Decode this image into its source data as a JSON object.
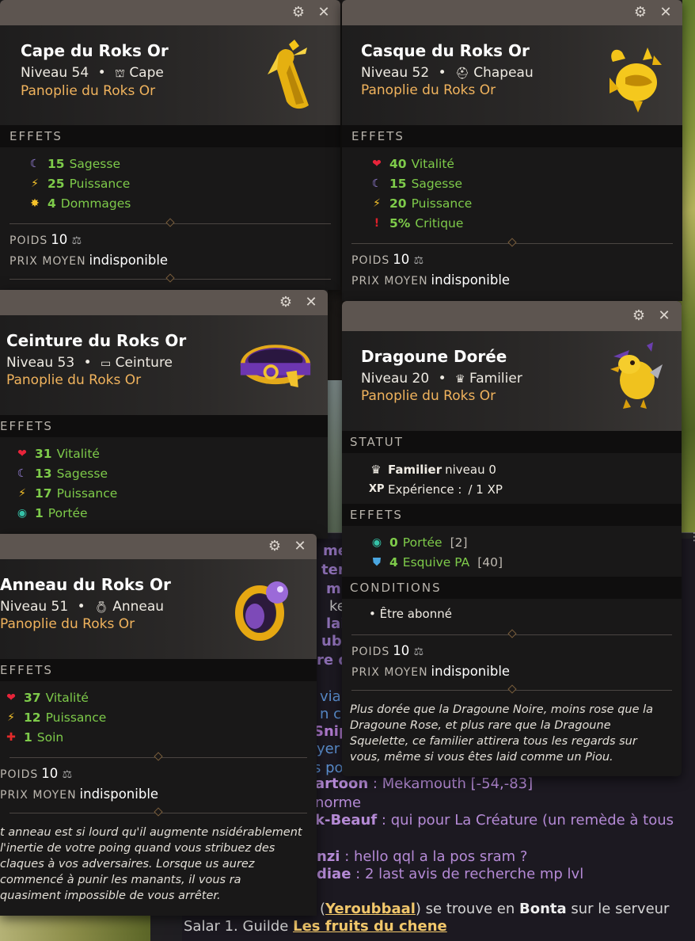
{
  "chat": {
    "lines": [
      {
        "name": "artoon",
        "message": ": Mekamouth [-54,-83]"
      },
      {
        "name": "",
        "message": "norme"
      },
      {
        "name": "k-Beauf",
        "message": ": qui pour La Créature (un remède à tous"
      },
      {
        "name": "nzi",
        "message": ": hello qql a la pos sram ?"
      },
      {
        "name": "diae",
        "message": ": 2 last avis de recherche mp lvl"
      }
    ],
    "system_line1": {
      "pre": "(",
      "user": "Yeroubbaal",
      "mid": ") se trouve en ",
      "place": "Bonta",
      "post": " sur le serveur"
    },
    "system_line2": {
      "pre": "Salar 1. Guilde ",
      "guild": "Les fruits du chene"
    },
    "fragments": [
      "me",
      "ter",
      "mp",
      "ke",
      "lai",
      "ub",
      "re d",
      "via",
      "n co",
      "Snip",
      "yer",
      "s po"
    ]
  },
  "cape": {
    "title": "Cape du Roks Or",
    "level": "Niveau 54",
    "type": "Cape",
    "set": "Panoplie du Roks Or",
    "effects_header": "EFFETS",
    "effects": [
      {
        "icon": "wisdom-icon",
        "value": "15",
        "label": "Sagesse"
      },
      {
        "icon": "power-icon",
        "value": "25",
        "label": "Puissance"
      },
      {
        "icon": "damage-icon",
        "value": "4",
        "label": "Dommages"
      }
    ],
    "weight_label": "POIDS",
    "weight_value": "10",
    "price_label": "PRIX MOYEN",
    "price_value": "indisponible"
  },
  "casque": {
    "title": "Casque du Roks Or",
    "level": "Niveau 52",
    "type": "Chapeau",
    "set": "Panoplie du Roks Or",
    "effects_header": "EFFETS",
    "effects": [
      {
        "icon": "vitality-icon",
        "value": "40",
        "label": "Vitalité"
      },
      {
        "icon": "wisdom-icon",
        "value": "15",
        "label": "Sagesse"
      },
      {
        "icon": "power-icon",
        "value": "20",
        "label": "Puissance"
      },
      {
        "icon": "critical-icon",
        "value": "5%",
        "label": "Critique"
      }
    ],
    "weight_label": "POIDS",
    "weight_value": "10",
    "price_label": "PRIX MOYEN",
    "price_value": "indisponible"
  },
  "ceinture": {
    "title": "Ceinture du Roks Or",
    "level": "Niveau 53",
    "type": "Ceinture",
    "set": "Panoplie du Roks Or",
    "effects_header": "EFFETS",
    "effects": [
      {
        "icon": "vitality-icon",
        "value": "31",
        "label": "Vitalité"
      },
      {
        "icon": "wisdom-icon",
        "value": "13",
        "label": "Sagesse"
      },
      {
        "icon": "power-icon",
        "value": "17",
        "label": "Puissance"
      },
      {
        "icon": "range-icon",
        "value": "1",
        "label": "Portée"
      }
    ]
  },
  "anneau": {
    "title": "Anneau du Roks Or",
    "level": "Niveau 51",
    "type": "Anneau",
    "set": "Panoplie du Roks Or",
    "effects_header": "EFFETS",
    "effects": [
      {
        "icon": "vitality-icon",
        "value": "37",
        "label": "Vitalité"
      },
      {
        "icon": "power-icon",
        "value": "12",
        "label": "Puissance"
      },
      {
        "icon": "heal-icon",
        "value": "1",
        "label": "Soin"
      }
    ],
    "weight_label": "POIDS",
    "weight_value": "10",
    "price_label": "PRIX MOYEN",
    "price_value": "indisponible",
    "description": "t anneau est si lourd qu'il augmente nsidérablement l'inertie de votre poing quand vous stribuez des claques à vos adversaires. Lorsque us aurez commencé à punir les manants, il vous ra quasiment impossible de vous arrêter."
  },
  "dragoune": {
    "title": "Dragoune Dorée",
    "level": "Niveau 20",
    "type": "Familier",
    "set": "Panoplie du Roks Or",
    "status_header": "STATUT",
    "status_pet_label": "Familier",
    "status_pet_value": "niveau 0",
    "status_xp_label": "Expérience :",
    "status_xp_value": "/ 1 XP",
    "effects_header": "EFFETS",
    "effects": [
      {
        "icon": "range-icon",
        "value": "0",
        "label": "Portée",
        "extra": "[2]"
      },
      {
        "icon": "ap-dodge-icon",
        "value": "4",
        "label": "Esquive PA",
        "extra": "[40]"
      }
    ],
    "conditions_header": "CONDITIONS",
    "condition": "• Être abonné",
    "weight_label": "POIDS",
    "weight_value": "10",
    "price_label": "PRIX MOYEN",
    "price_value": "indisponible",
    "description": "Plus dorée que la Dragoune Noire, moins rose que la Dragoune Rose, et plus rare que la Dragoune Squelette, ce familier attirera tous les regards sur vous, même si vous êtes laid comme un Piou."
  },
  "colors": {
    "effect_green": "#7ecb4a",
    "set_orange": "#f0b35d",
    "chat_purple": "#b58ad6",
    "link_gold": "#f1c76b"
  }
}
